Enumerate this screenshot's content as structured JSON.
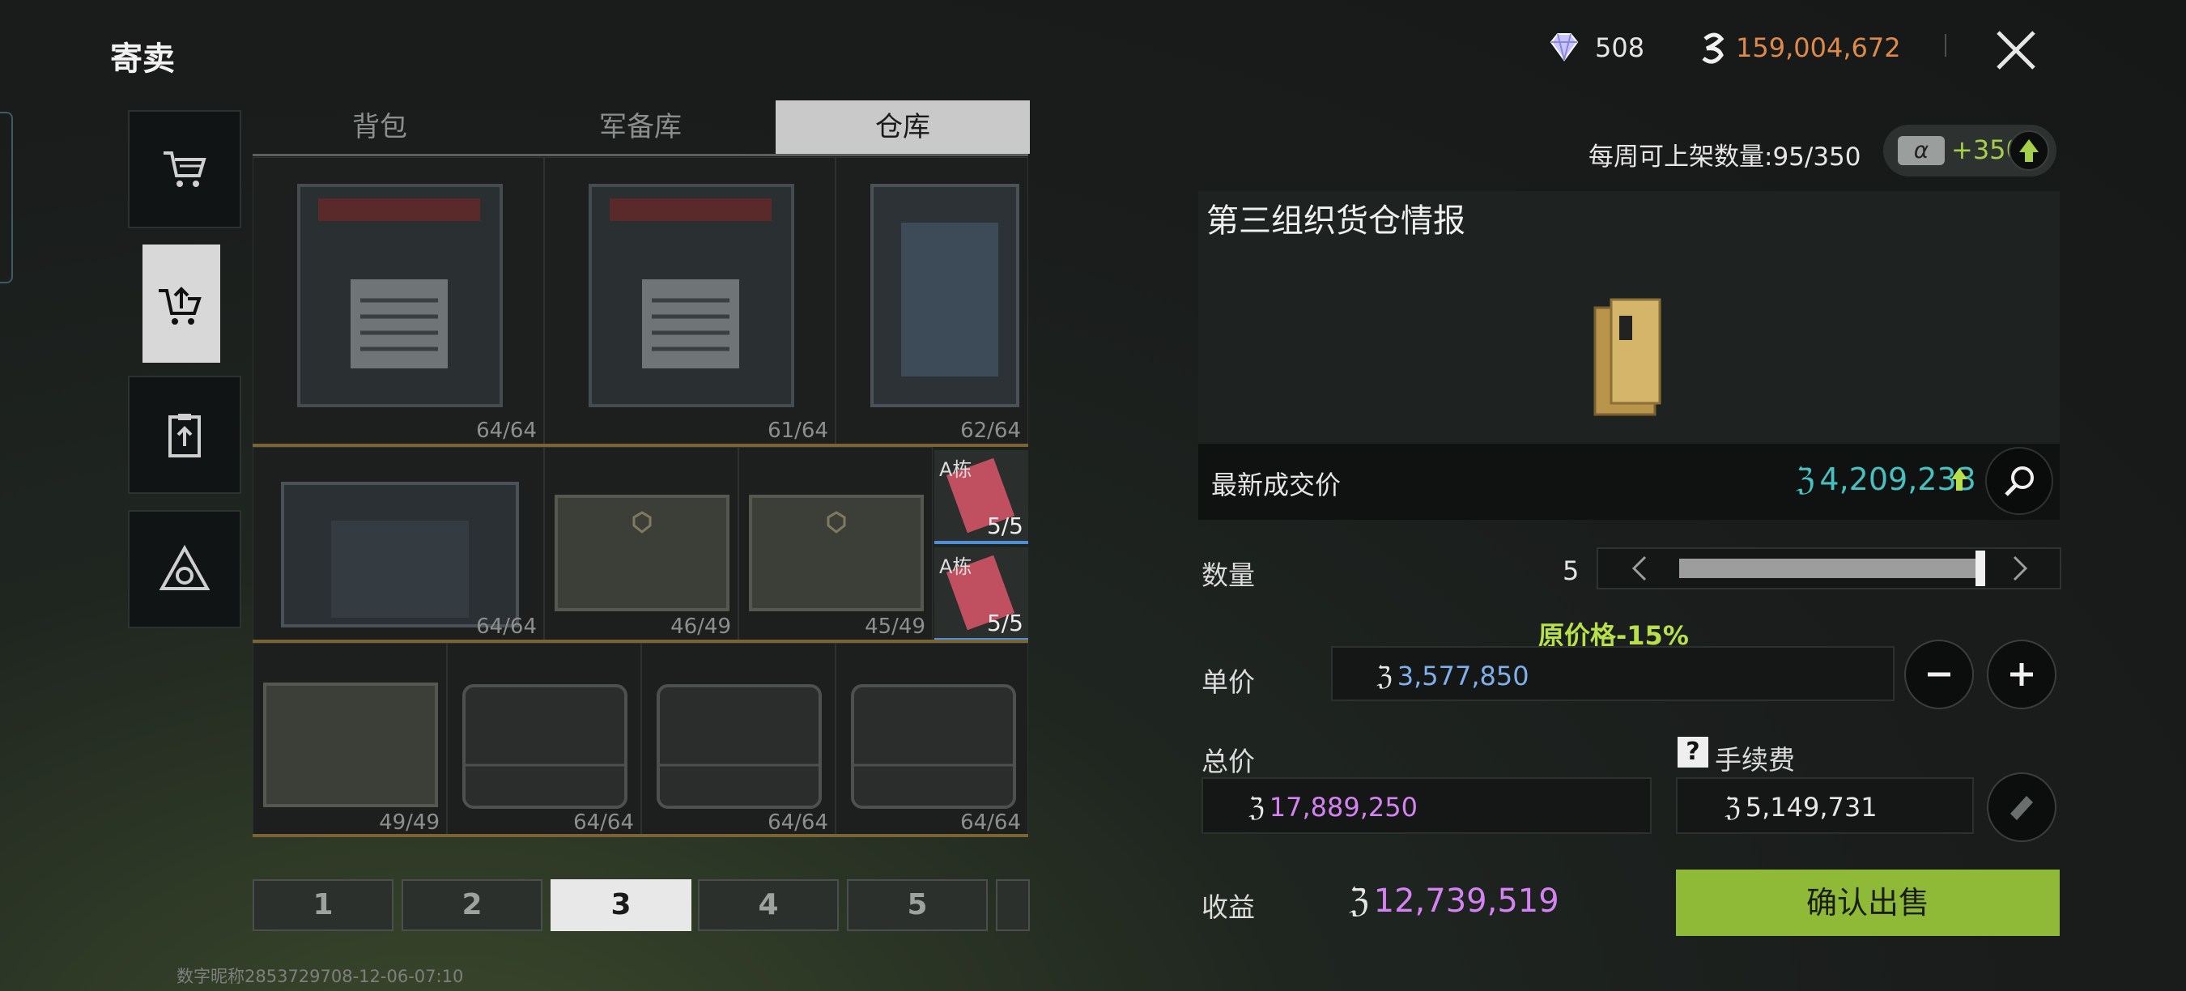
{
  "header": {
    "title": "寄卖"
  },
  "sidebar": {
    "items": [
      {
        "icon": "cart-icon"
      },
      {
        "icon": "cart-upload-icon"
      },
      {
        "icon": "clipboard-upload-icon"
      },
      {
        "icon": "triangle-logo-icon"
      }
    ]
  },
  "tabs": [
    "背包",
    "军备库",
    "仓库"
  ],
  "active_tab": 2,
  "grid": {
    "rows": [
      [
        {
          "qty": "64/64",
          "type": "crate"
        },
        {
          "qty": "61/64",
          "type": "crate"
        },
        {
          "qty": "62/64",
          "type": "crate-side"
        }
      ],
      [
        {
          "qty": "64/64",
          "type": "case"
        },
        {
          "qty": "46/49",
          "type": "box"
        },
        {
          "qty": "45/49",
          "type": "box"
        }
      ],
      [
        {
          "qty": "49/49",
          "type": "box"
        },
        {
          "qty": "64/64",
          "type": "briefcase"
        },
        {
          "qty": "64/64",
          "type": "briefcase"
        },
        {
          "qty": "64/64",
          "type": "briefcase"
        }
      ]
    ],
    "mini": [
      {
        "tag": "A栋",
        "qty": "5/5"
      },
      {
        "tag": "A栋",
        "qty": "5/5"
      }
    ]
  },
  "pager": {
    "pages": [
      "1",
      "2",
      "3",
      "4",
      "5",
      ""
    ],
    "active": 2
  },
  "footer": "数字昵称2853729708-12-06-07:10",
  "currency": {
    "gems": "508",
    "coins": "159,004,672"
  },
  "weekly": {
    "label": "每周可上架数量:95/350",
    "bonus": "+350"
  },
  "item": {
    "name": "第三组织货仓情报",
    "latest_price_label": "最新成交价",
    "latest_price": "4,209,233"
  },
  "sale": {
    "quantity_label": "数量",
    "quantity": "5",
    "quantity_level": 1.0,
    "discount_text": "原价格-15%",
    "unit_label": "单价",
    "unit_price": "3,577,850",
    "total_label": "总价",
    "total_price": "17,889,250",
    "fee_label": "手续费",
    "fee": "5,149,731",
    "fee_help": "?",
    "profit_label": "收益",
    "profit": "12,739,519",
    "confirm_label": "确认出售"
  },
  "colors": {
    "accent_green": "#8fba38",
    "coin_orange": "#e08a4a",
    "price_teal": "#48c0c0",
    "purple": "#d582f2",
    "blue": "#7fb0ec"
  }
}
